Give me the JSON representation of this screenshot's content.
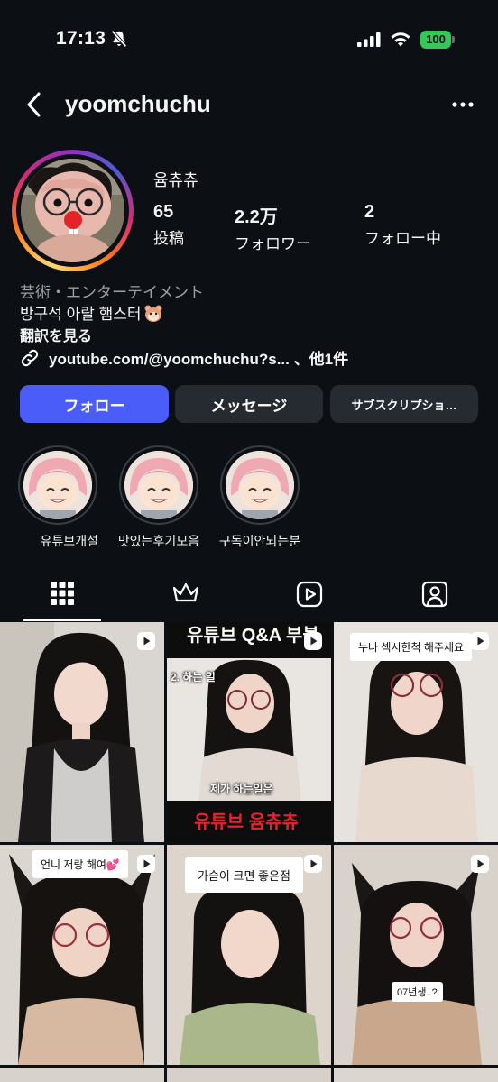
{
  "status_bar": {
    "time": "17:13",
    "battery": "100",
    "icons": [
      "bell-slash-icon",
      "signal-icon",
      "wifi-icon",
      "battery-icon"
    ]
  },
  "header": {
    "username": "yoomchuchu",
    "back_icon": "chevron-left-icon",
    "more_icon": "more-horizontal-icon"
  },
  "profile": {
    "display_name": "윰츄츄",
    "stats": [
      {
        "value": "65",
        "label": "投稿"
      },
      {
        "value": "2.2万",
        "label": "フォロワー"
      },
      {
        "value": "2",
        "label": "フォロー中"
      }
    ],
    "category": "芸術・エンターテイメント",
    "bio": "방구석 아랄 햄스터",
    "translate": "翻訳を見る",
    "link": "youtube.com/@yoomchuchu?s...",
    "link_suffix": "、他1件"
  },
  "buttons": {
    "follow": "フォロー",
    "message": "メッセージ",
    "subscription": "サブスクリプショ…"
  },
  "highlights": [
    {
      "label": "유튜브개설"
    },
    {
      "label": "맛있는후기모음"
    },
    {
      "label": "구독이안되는분"
    }
  ],
  "tabs": [
    {
      "icon": "grid-icon",
      "active": true
    },
    {
      "icon": "crown-icon",
      "active": false
    },
    {
      "icon": "reels-icon",
      "active": false
    },
    {
      "icon": "tagged-icon",
      "active": false
    }
  ],
  "posts": [
    {
      "overlay": "",
      "reel": true
    },
    {
      "overlay_top": "유튜브 Q&A 부볼",
      "overlay_mid": "2. 하는 일",
      "overlay_sub": "제가 하는일은",
      "overlay_bottom": "유튜브 윰츄츄",
      "reel": true
    },
    {
      "caption": "누나 섹시한척 해주세요",
      "reel": true
    },
    {
      "caption": "언니 저랑 해여💕",
      "reel": true
    },
    {
      "caption": "가슴이 크면 좋은점",
      "reel": true
    },
    {
      "overlay": "07년생..?",
      "reel": true
    }
  ],
  "colors": {
    "background": "#0c0f14",
    "follow_button": "#4a5df9",
    "secondary_button": "#262a31",
    "muted_text": "#9aa0a6",
    "battery": "#35c759"
  }
}
